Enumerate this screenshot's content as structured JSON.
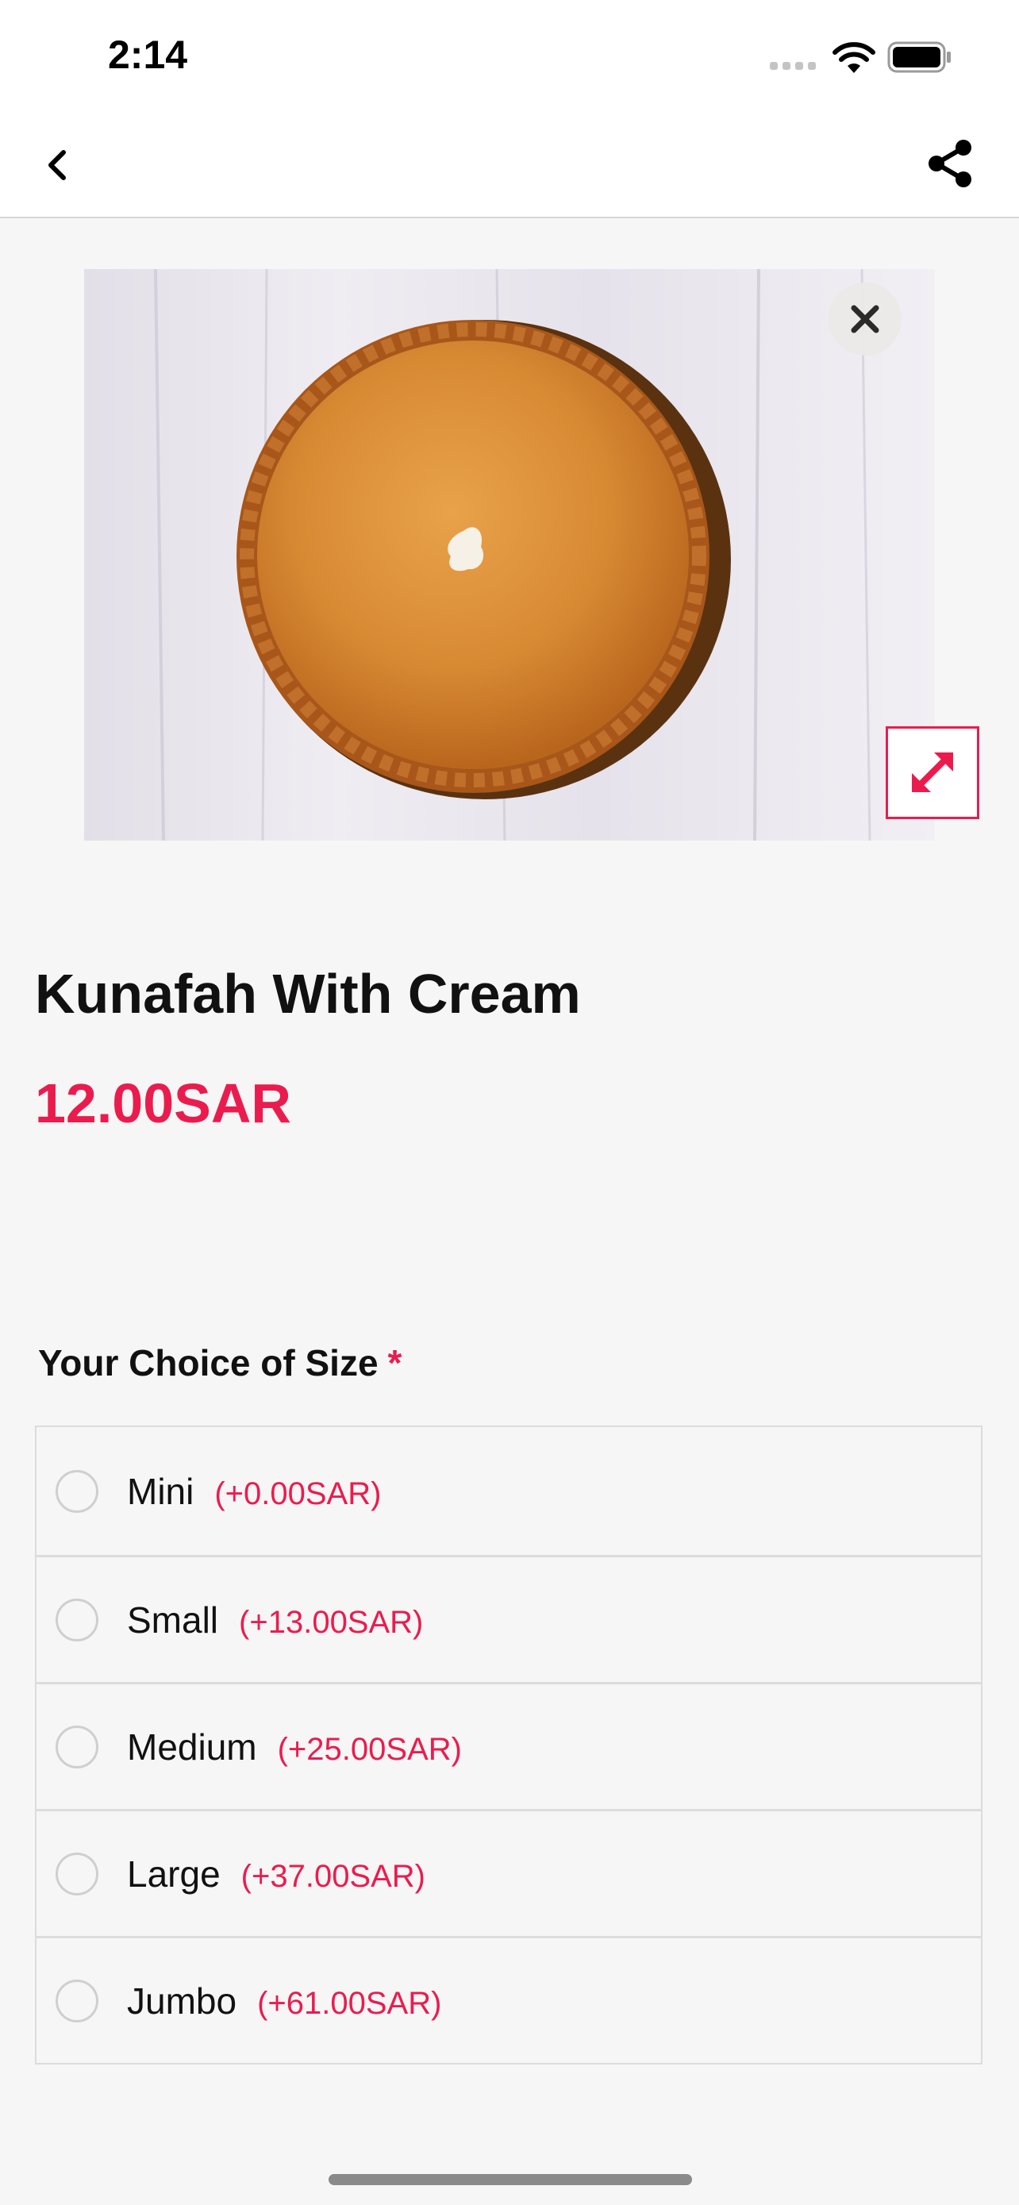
{
  "status_bar": {
    "time": "2:14"
  },
  "item": {
    "title": "Kunafah With Cream",
    "price": "12.00SAR"
  },
  "size_section": {
    "title": "Your Choice of Size",
    "required_mark": "*",
    "options": [
      {
        "name": "Mini",
        "price": "(+0.00SAR)"
      },
      {
        "name": "Small",
        "price": "(+13.00SAR)"
      },
      {
        "name": "Medium",
        "price": "(+25.00SAR)"
      },
      {
        "name": "Large",
        "price": "(+37.00SAR)"
      },
      {
        "name": "Jumbo",
        "price": "(+61.00SAR)"
      }
    ]
  },
  "icons": {
    "back": "chevron-left-icon",
    "share": "share-icon",
    "close": "close-icon",
    "expand": "expand-icon"
  },
  "colors": {
    "accent": "#ea1c4e",
    "background": "#f6f6f6"
  }
}
